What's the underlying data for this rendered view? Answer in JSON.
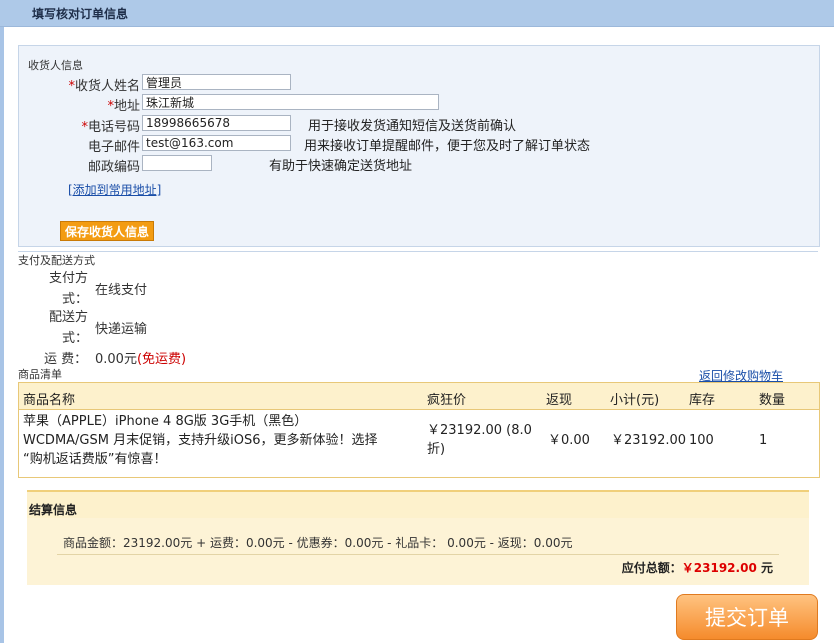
{
  "header": {
    "title": "填写核对订单信息"
  },
  "consignee": {
    "section_title": "收货人信息",
    "required_mark": "*",
    "name_label": "收货人姓名：",
    "name_value": "管理员",
    "address_label": "地址：",
    "address_value": "珠江新城",
    "phone_label": "电话号码：",
    "phone_value": "18998665678",
    "phone_hint": "用于接收发货通知短信及送货前确认",
    "email_label": "电子邮件：",
    "email_value": "test@163.com",
    "email_hint": "用来接收订单提醒邮件，便于您及时了解订单状态",
    "zip_label": "邮政编码：",
    "zip_value": "",
    "zip_hint": "有助于快速确定送货地址",
    "add_link": "[添加到常用地址]",
    "save_button": "保存收货人信息"
  },
  "payment": {
    "section_title": "支付及配送方式",
    "pay_label_1": "支付方",
    "pay_label_2": "式：",
    "pay_value": "在线支付",
    "ship_label_1": "配送方",
    "ship_label_2": "式：",
    "ship_value": "快递运输",
    "fee_label": "运 费：",
    "fee_value": "0.00元",
    "fee_note": "(免运费)"
  },
  "goods": {
    "section_title": "商品清单",
    "back_link": "返回修改购物车",
    "columns": {
      "name": "商品名称",
      "price": "疯狂价",
      "rebate": "返现",
      "subtotal": "小计(元)",
      "stock": "库存",
      "qty": "数量"
    },
    "rows": [
      {
        "name_line1": "苹果（APPLE）iPhone 4 8G版 3G手机（黑色）",
        "name_line2": "WCDMA/GSM 月末促销，支持升级iOS6，更多新体验！选择",
        "name_line3": "“购机返话费版”有惊喜！",
        "price_line1": "￥23192.00 (8.0",
        "price_line2": "折)",
        "rebate": "￥0.00",
        "subtotal": "￥23192.00",
        "stock": "100",
        "qty": "1"
      }
    ]
  },
  "settlement": {
    "title": "结算信息",
    "formula": "商品金额：23192.00元 + 运费：0.00元 - 优惠券：0.00元 - 礼品卡： 0.00元 - 返现：0.00元",
    "total_label": "应付总额：",
    "total_amount": "￥23192.00",
    "total_unit": "元"
  },
  "submit_button": "提交订单"
}
